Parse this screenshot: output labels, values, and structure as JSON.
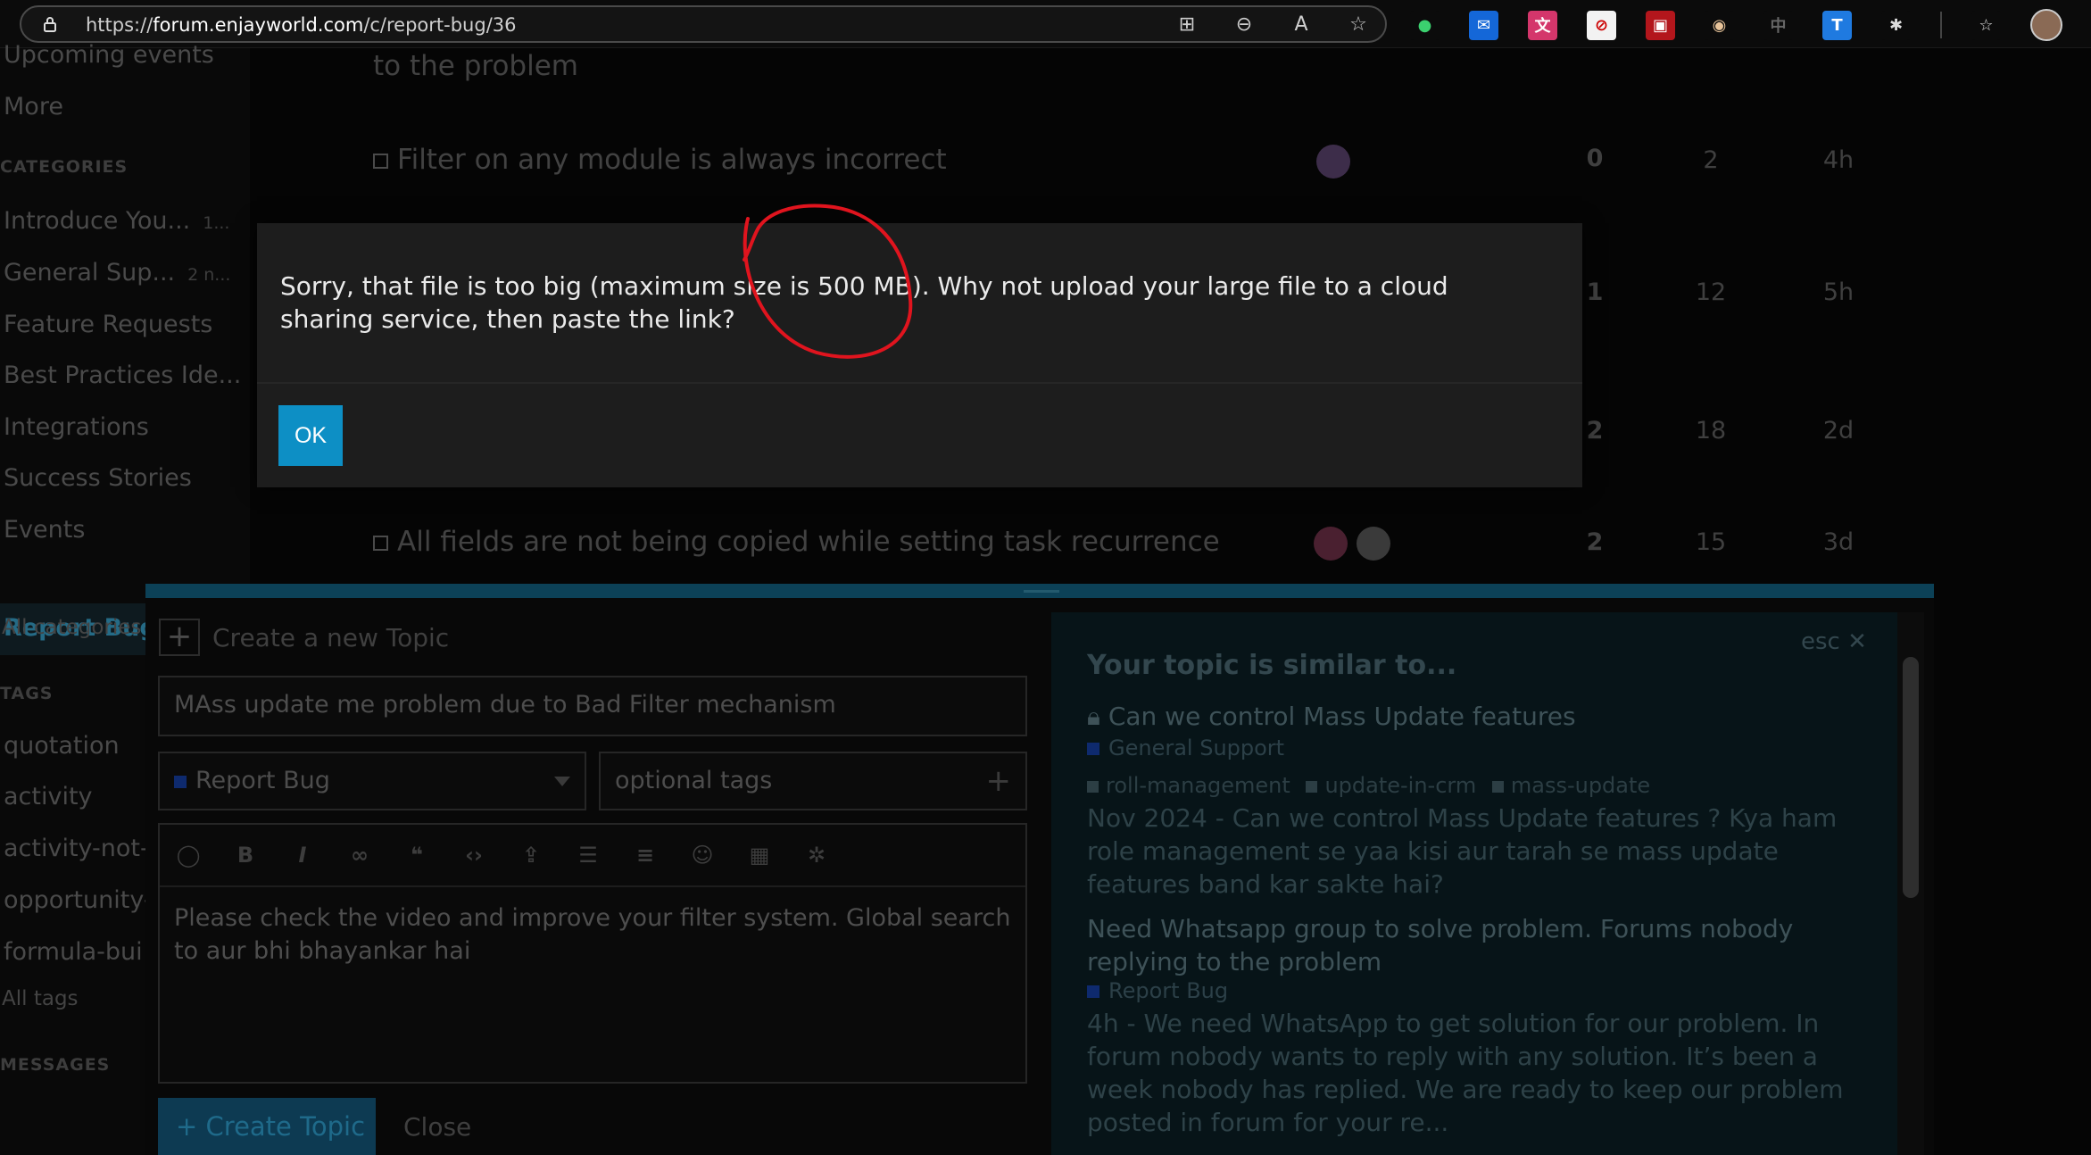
{
  "browser": {
    "url_prefix": "https://",
    "url_host": "forum.enjayworld.com",
    "url_path": "/c/report-bug/36"
  },
  "sidebar": {
    "items_top": [
      {
        "label": "Upcoming events"
      },
      {
        "label": "More"
      }
    ],
    "categories_heading": "CATEGORIES",
    "categories": [
      {
        "label": "Introduce You...",
        "count": "1..."
      },
      {
        "label": "General Sup...",
        "count": "2 n..."
      },
      {
        "label": "Feature Requests",
        "count": ""
      },
      {
        "label": "Best Practices Ide...",
        "count": ""
      },
      {
        "label": "Integrations",
        "count": ""
      },
      {
        "label": "Success Stories",
        "count": ""
      },
      {
        "label": "Events",
        "count": ""
      }
    ],
    "active_category": "Report Bug",
    "all_categories": "All categories",
    "tags_heading": "TAGS",
    "tags": [
      "quotation",
      "activity",
      "activity-not-",
      "opportunity-",
      "formula-bui"
    ],
    "all_tags": "All tags",
    "messages_heading": "MESSAGES"
  },
  "topics": [
    {
      "title": "to the problem",
      "replies": "",
      "views": "",
      "activity": ""
    },
    {
      "title": "Filter on any module is always incorrect",
      "replies": "0",
      "views": "2",
      "activity": "4h"
    },
    {
      "title": "",
      "replies": "1",
      "views": "12",
      "activity": "5h"
    },
    {
      "title": "",
      "replies": "2",
      "views": "18",
      "activity": "2d"
    },
    {
      "title": "All fields are not being copied while setting task recurrence",
      "replies": "2",
      "views": "15",
      "activity": "3d"
    }
  ],
  "composer": {
    "header": "Create a new Topic",
    "title_value": "MAss update me problem due to Bad Filter mechanism",
    "category": "Report Bug",
    "tags_placeholder": "optional tags",
    "body_text": "Please check the video and improve your filter system. Global search to aur bhi bhayankar hai",
    "create_label": "Create Topic",
    "close_label": "Close"
  },
  "similar": {
    "title": "Your topic is similar to...",
    "esc_label": "esc",
    "items": [
      {
        "title": "Can we control Mass Update features",
        "category": "General Support",
        "tags": [
          "roll-management",
          "update-in-crm",
          "mass-update"
        ],
        "excerpt": "Nov 2024 - Can we control Mass Update features ? Kya ham role management se yaa kisi aur tarah se mass update features band kar sakte hai?"
      },
      {
        "title": "Need Whatsapp group to solve problem. Forums nobody replying to the problem",
        "category": "Report Bug",
        "excerpt": "4h - We need WhatsApp to get solution for our problem. In forum nobody wants to reply with any solution. It’s been a week nobody has replied. We are ready to keep our problem posted in forum for your re..."
      }
    ]
  },
  "modal": {
    "message": "Sorry, that file is too big (maximum size is 500 MB). Why not upload your large file to a cloud sharing service, then paste the link?",
    "ok_label": "OK"
  },
  "colors": {
    "accent": "#0d8fc5",
    "annotation": "#e0141e"
  }
}
